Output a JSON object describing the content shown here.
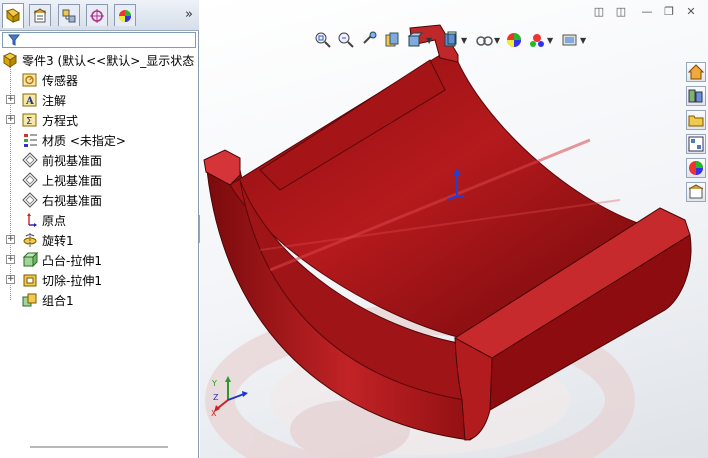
{
  "tree": {
    "root": "零件3 (默认<<默认>_显示状态",
    "items": [
      {
        "label": "传感器"
      },
      {
        "label": "注解"
      },
      {
        "label": "方程式"
      },
      {
        "label": "材质 <未指定>"
      },
      {
        "label": "前视基准面"
      },
      {
        "label": "上视基准面"
      },
      {
        "label": "右视基准面"
      },
      {
        "label": "原点"
      },
      {
        "label": "旋转1"
      },
      {
        "label": "凸台-拉伸1"
      },
      {
        "label": "切除-拉伸1"
      },
      {
        "label": "组合1"
      }
    ]
  },
  "panel_tabs": [
    "feature-manager",
    "property-manager",
    "configuration-manager",
    "dim-xpert-manager",
    "display-manager"
  ],
  "triad": {
    "x": "X",
    "y": "Y",
    "z": "Z"
  },
  "colors": {
    "part": "#b31215",
    "part_dark": "#7a0a0c",
    "part_light": "#d9373a"
  }
}
